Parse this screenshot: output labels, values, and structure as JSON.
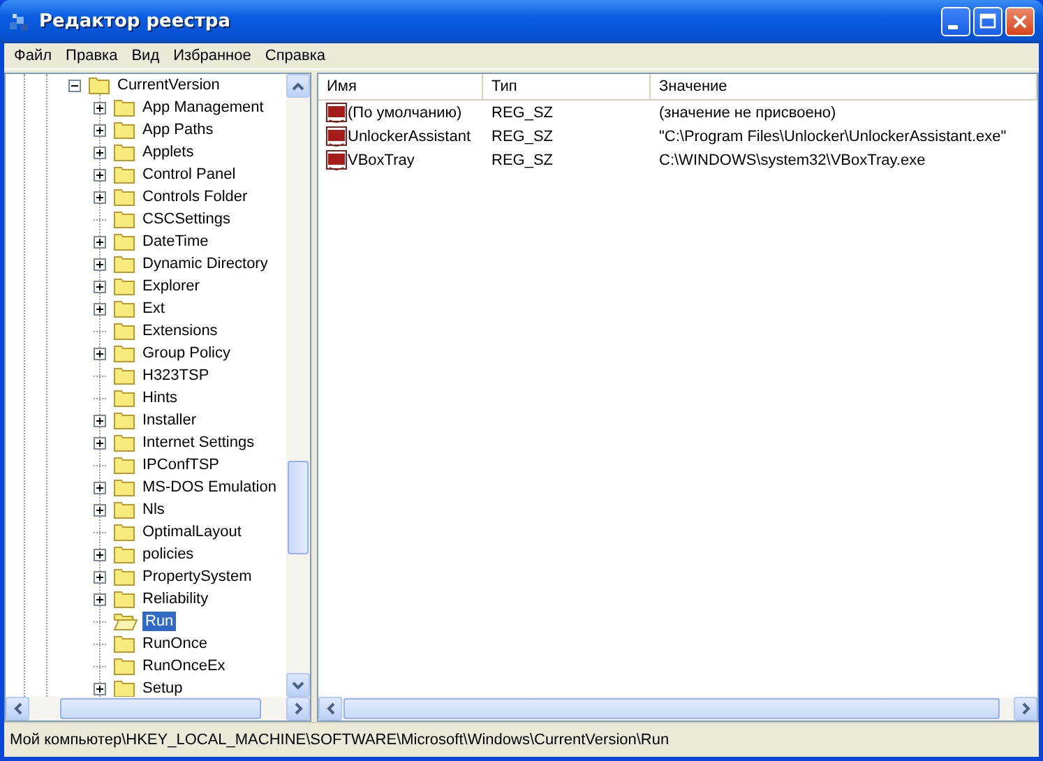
{
  "window": {
    "title": "Редактор реестра"
  },
  "menu": [
    "Файл",
    "Правка",
    "Вид",
    "Избранное",
    "Справка"
  ],
  "tree": {
    "label": "CurrentVersion",
    "expanded": true,
    "selected": false,
    "children": [
      {
        "label": "App Management",
        "expandable": true,
        "selected": false
      },
      {
        "label": "App Paths",
        "expandable": true,
        "selected": false
      },
      {
        "label": "Applets",
        "expandable": true,
        "selected": false
      },
      {
        "label": "Control Panel",
        "expandable": true,
        "selected": false
      },
      {
        "label": "Controls Folder",
        "expandable": true,
        "selected": false
      },
      {
        "label": "CSCSettings",
        "expandable": false,
        "selected": false
      },
      {
        "label": "DateTime",
        "expandable": true,
        "selected": false
      },
      {
        "label": "Dynamic Directory",
        "expandable": true,
        "selected": false
      },
      {
        "label": "Explorer",
        "expandable": true,
        "selected": false
      },
      {
        "label": "Ext",
        "expandable": true,
        "selected": false
      },
      {
        "label": "Extensions",
        "expandable": false,
        "selected": false
      },
      {
        "label": "Group Policy",
        "expandable": true,
        "selected": false
      },
      {
        "label": "H323TSP",
        "expandable": false,
        "selected": false
      },
      {
        "label": "Hints",
        "expandable": false,
        "selected": false
      },
      {
        "label": "Installer",
        "expandable": true,
        "selected": false
      },
      {
        "label": "Internet Settings",
        "expandable": true,
        "selected": false
      },
      {
        "label": "IPConfTSP",
        "expandable": false,
        "selected": false
      },
      {
        "label": "MS-DOS Emulation",
        "expandable": true,
        "selected": false
      },
      {
        "label": "Nls",
        "expandable": true,
        "selected": false
      },
      {
        "label": "OptimalLayout",
        "expandable": false,
        "selected": false
      },
      {
        "label": "policies",
        "expandable": true,
        "selected": false
      },
      {
        "label": "PropertySystem",
        "expandable": true,
        "selected": false
      },
      {
        "label": "Reliability",
        "expandable": true,
        "selected": false
      },
      {
        "label": "Run",
        "expandable": false,
        "selected": true
      },
      {
        "label": "RunOnce",
        "expandable": false,
        "selected": false
      },
      {
        "label": "RunOnceEx",
        "expandable": false,
        "selected": false
      },
      {
        "label": "Setup",
        "expandable": true,
        "selected": false
      }
    ]
  },
  "table": {
    "columns": [
      "Имя",
      "Тип",
      "Значение"
    ],
    "rows": [
      {
        "name": "(По умолчанию)",
        "type": "REG_SZ",
        "value": "(значение не присвоено)"
      },
      {
        "name": "UnlockerAssistant",
        "type": "REG_SZ",
        "value": "\"C:\\Program Files\\Unlocker\\UnlockerAssistant.exe\""
      },
      {
        "name": "VBoxTray",
        "type": "REG_SZ",
        "value": "C:\\WINDOWS\\system32\\VBoxTray.exe"
      }
    ]
  },
  "status_bar": "Мой компьютер\\HKEY_LOCAL_MACHINE\\SOFTWARE\\Microsoft\\Windows\\CurrentVersion\\Run"
}
